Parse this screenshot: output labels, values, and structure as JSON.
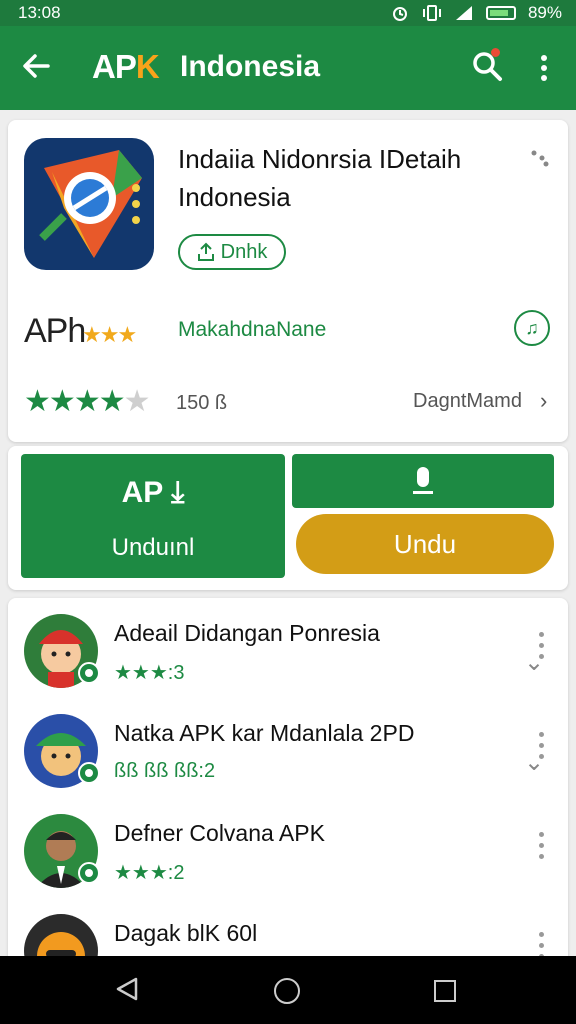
{
  "status_bar": {
    "time": "13:08",
    "battery": "89%"
  },
  "app_bar": {
    "logo_ap": "AP",
    "logo_k": "K",
    "brand": "Indonesia",
    "brand_color": "#1d8a43",
    "accent_color": "#f8a31a",
    "icons": [
      "back-arrow-icon",
      "search-icon",
      "more-vert-icon"
    ]
  },
  "app_card": {
    "title_line1": "Indaiia Nidonrsia IDetaih",
    "title_line2": "Indonesia",
    "download_pill_label": "Dnhk",
    "aph_text": "APh",
    "mini_stars": "★★★",
    "maker": "MakahdnaNane",
    "rating_stars_filled": 4,
    "rating_stars_total": 5,
    "count_label": "150 ß",
    "developer": "DagntMamd",
    "icons": [
      "app-icon",
      "share-icon",
      "download-icon",
      "music-note-icon",
      "chevron-right-icon"
    ]
  },
  "download_card": {
    "primary_top": "AP",
    "primary_bottom": "Unduınl",
    "secondary_label": "Undu",
    "secondary_color": "#d39d16"
  },
  "list": [
    {
      "title": "Adeail Didangan Ponresia",
      "rating_text": "★★★:3"
    },
    {
      "title": "Natka APK kar Mdanlala 2PD",
      "rating_text": "ßß ßß ßß:2"
    },
    {
      "title": "Defner Colvana APK",
      "rating_text": "★★★:2"
    },
    {
      "title": "Dagak blK 60l",
      "rating_text": ""
    }
  ],
  "navbar": {
    "icons": [
      "nav-back-icon",
      "nav-home-icon",
      "nav-recents-icon"
    ]
  }
}
